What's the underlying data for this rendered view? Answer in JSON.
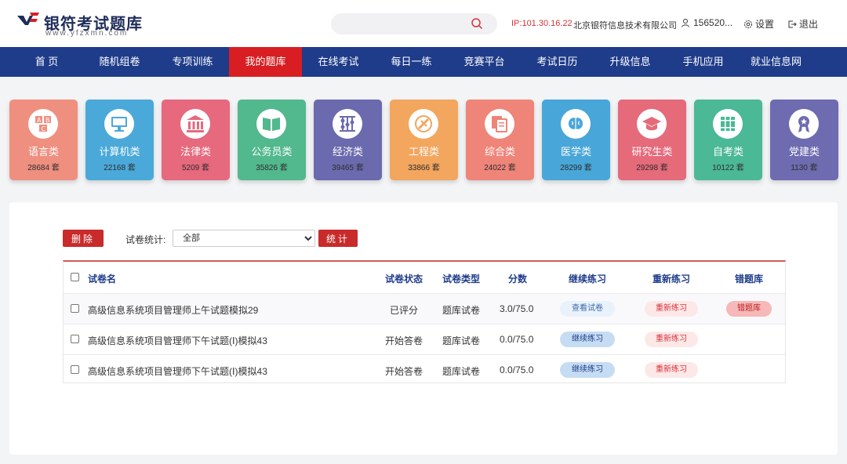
{
  "header": {
    "logo_text": "银符考试题库",
    "logo_sub": "www.yfzxmn.com",
    "search_placeholder": "",
    "ip_text": "IP:101.30.16.22",
    "company": "北京银符信息技术有限公司",
    "user": "156520...",
    "settings": "设置",
    "logout": "退出"
  },
  "nav": {
    "items": [
      "首 页",
      "随机组卷",
      "专项训练",
      "我的题库",
      "在线考试",
      "每日一练",
      "竞赛平台",
      "考试日历",
      "升级信息",
      "手机应用",
      "就业信息网"
    ],
    "active_index": 3
  },
  "categories": [
    {
      "name": "语言类",
      "count": "28684 套",
      "color": "#ef8f80",
      "icon": "abc-blocks-icon"
    },
    {
      "name": "计算机类",
      "count": "22168 套",
      "color": "#4aa9d9",
      "icon": "monitor-icon"
    },
    {
      "name": "法律类",
      "count": "5209 套",
      "color": "#e6697d",
      "icon": "courthouse-icon"
    },
    {
      "name": "公务员类",
      "count": "35826 套",
      "color": "#52b88e",
      "icon": "book-icon"
    },
    {
      "name": "经济类",
      "count": "39465 套",
      "color": "#6b6aae",
      "icon": "abacus-icon"
    },
    {
      "name": "工程类",
      "count": "33866 套",
      "color": "#f2a65e",
      "icon": "ruler-icon"
    },
    {
      "name": "综合类",
      "count": "24022 套",
      "color": "#ef8478",
      "icon": "documents-icon"
    },
    {
      "name": "医学类",
      "count": "28299 套",
      "color": "#49a6d8",
      "icon": "brain-icon"
    },
    {
      "name": "研究生类",
      "count": "29298 套",
      "color": "#e56a7a",
      "icon": "graduation-cap-icon"
    },
    {
      "name": "自考类",
      "count": "10122 套",
      "color": "#4bb896",
      "icon": "books-icon"
    },
    {
      "name": "党建类",
      "count": "1130 套",
      "color": "#6e6bb0",
      "icon": "medal-icon"
    }
  ],
  "toolbar": {
    "delete_label": "删除",
    "stat_label": "试卷统计:",
    "stat_selected": "全部",
    "stat_button": "统计"
  },
  "table": {
    "headers": {
      "name": "试卷名",
      "status": "试卷状态",
      "type": "试卷类型",
      "score": "分数",
      "continue": "继续练习",
      "redo": "重新练习",
      "wrong": "错题库"
    },
    "rows": [
      {
        "name": "高级信息系统项目管理师上午试题模拟29",
        "status": "已评分",
        "type": "题库试卷",
        "score": "3.0/75.0",
        "continue": "查看试卷",
        "redo": "重新练习",
        "wrong": "错题库"
      },
      {
        "name": "高级信息系统项目管理师下午试题(Ⅰ)模拟43",
        "status": "开始答卷",
        "type": "题库试卷",
        "score": "0.0/75.0",
        "continue": "继续练习",
        "redo": "重新练习",
        "wrong": ""
      },
      {
        "name": "高级信息系统项目管理师下午试题(Ⅰ)模拟43",
        "status": "开始答卷",
        "type": "题库试卷",
        "score": "0.0/75.0",
        "continue": "继续练习",
        "redo": "重新练习",
        "wrong": ""
      }
    ]
  }
}
